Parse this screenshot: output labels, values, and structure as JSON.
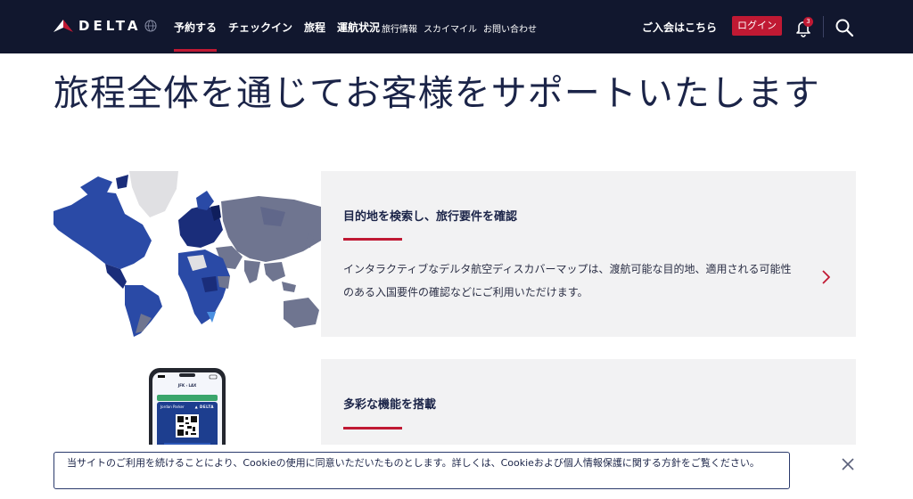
{
  "header": {
    "logo_text": "DELTA",
    "nav_main": [
      "予約する",
      "チェックイン",
      "旅程",
      "運航状況"
    ],
    "nav_sub": [
      "旅行情報",
      "スカイマイル",
      "お問い合わせ"
    ],
    "join_label": "ご入会はこちら",
    "login_label": "ログイン",
    "notification_count": "3",
    "icons": [
      "delta-widget-icon",
      "globe-icon",
      "bell-icon",
      "search-icon"
    ]
  },
  "hero": {
    "title": "旅程全体を通じてお客様をサポートいたします"
  },
  "cards": [
    {
      "title": "目的地を検索し、旅行要件を確認",
      "description": "インタラクティブなデルタ航空ディスカバーマップは、渡航可能な目的地、適用される可能性のある入国要件の確認などにご利用いただけます。",
      "image": "world-map"
    },
    {
      "title": "多彩な機能を搭載",
      "image": "phone-app",
      "phone": {
        "route": "JFK › LAX",
        "pass_name": "Jordan Parker",
        "pass_logo": "▲ DELTA"
      }
    }
  ],
  "cookie": {
    "text": "当サイトのご利用を続けることにより、Cookieの使用に同意いただいたものとします。詳しくは、Cookieおよび個人情報保護に関する方針をご覧ください。"
  },
  "colors": {
    "header_bg": "#11172e",
    "accent_red": "#c01933",
    "navy_text": "#1b2448",
    "panel_bg": "#f2f2f3"
  }
}
